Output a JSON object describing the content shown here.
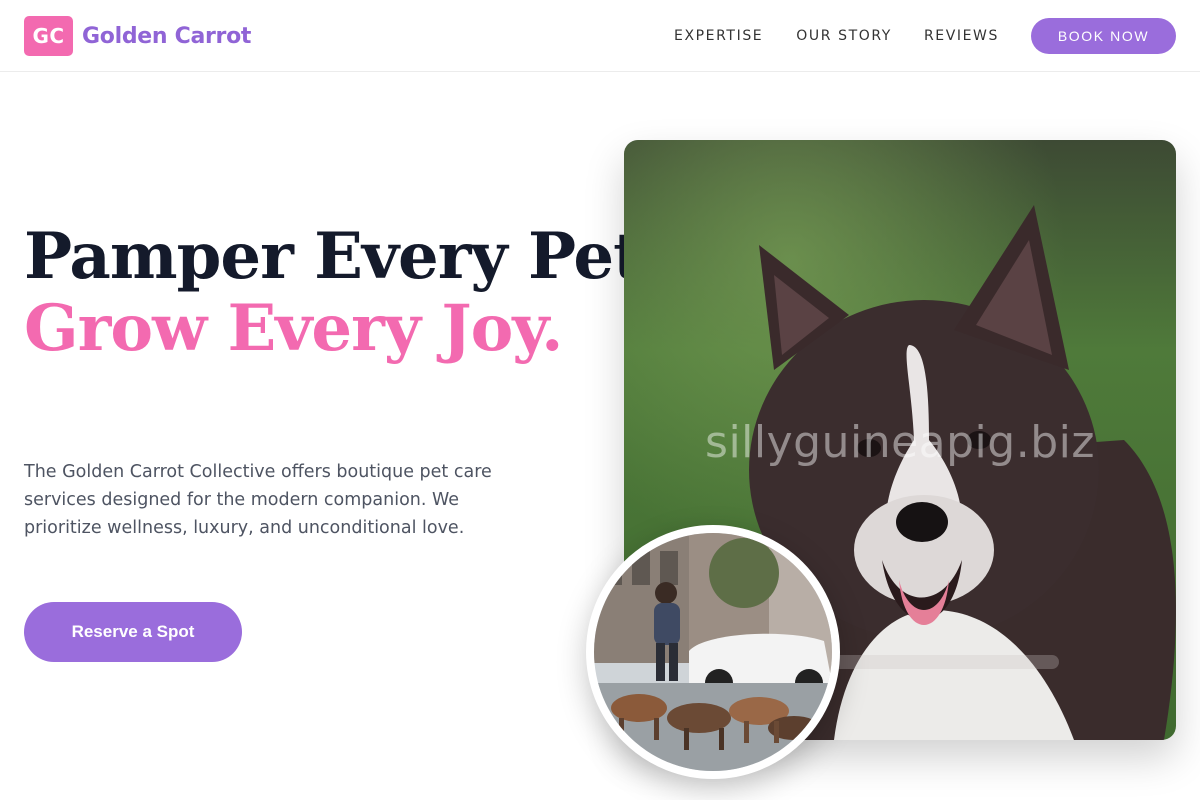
{
  "brand": {
    "mark": "GC",
    "name": "Golden Carrot",
    "mark_color": "#f36ab0",
    "accent_color": "#9a6ddc"
  },
  "nav": {
    "links": [
      "EXPERTISE",
      "OUR STORY",
      "REVIEWS"
    ],
    "cta": "BOOK NOW"
  },
  "hero": {
    "title_line1": "Pamper Every Pet,",
    "title_line2": "Grow Every Joy.",
    "description": "The Golden Carrot Collective offers boutique pet care services designed for the modern companion. We prioritize wellness, luxury, and unconditional love.",
    "cta": "Reserve a Spot"
  },
  "images": {
    "main": "dog-portrait-image",
    "secondary": "dog-walker-image",
    "watermark": "sillyguineapig.biz"
  }
}
